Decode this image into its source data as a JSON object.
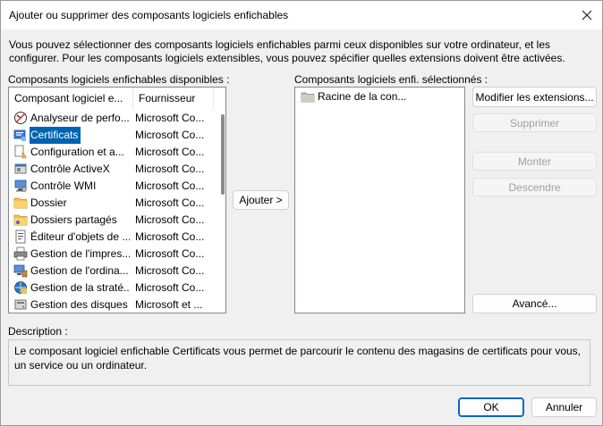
{
  "window": {
    "title": "Ajouter ou supprimer des composants logiciels enfichables",
    "close_icon": "close-icon"
  },
  "intro": "Vous pouvez sélectionner des composants logiciels enfichables parmi ceux disponibles sur votre ordinateur, et les configurer. Pour les composants logiciels extensibles, vous pouvez spécifier quelles extensions doivent être activées.",
  "available": {
    "label": "Composants logiciels enfichables disponibles :",
    "columns": [
      "Composant logiciel e...",
      "Fournisseur"
    ],
    "rows": [
      {
        "name": "Analyseur de perfo...",
        "vendor": "Microsoft Co...",
        "icon": "perf-analyzer-icon",
        "selected": false
      },
      {
        "name": "Certificats",
        "vendor": "Microsoft Co...",
        "icon": "certificates-icon",
        "selected": true
      },
      {
        "name": "Configuration et a...",
        "vendor": "Microsoft Co...",
        "icon": "config-analysis-icon",
        "selected": false
      },
      {
        "name": "Contrôle ActiveX",
        "vendor": "Microsoft Co...",
        "icon": "activex-icon",
        "selected": false
      },
      {
        "name": "Contrôle WMI",
        "vendor": "Microsoft Co...",
        "icon": "wmi-icon",
        "selected": false
      },
      {
        "name": "Dossier",
        "vendor": "Microsoft Co...",
        "icon": "folder-icon",
        "selected": false
      },
      {
        "name": "Dossiers partagés",
        "vendor": "Microsoft Co...",
        "icon": "shared-folders-icon",
        "selected": false
      },
      {
        "name": "Éditeur d'objets de ...",
        "vendor": "Microsoft Co...",
        "icon": "gpo-editor-icon",
        "selected": false
      },
      {
        "name": "Gestion de l'impres...",
        "vendor": "Microsoft Co...",
        "icon": "print-management-icon",
        "selected": false
      },
      {
        "name": "Gestion de l'ordina...",
        "vendor": "Microsoft Co...",
        "icon": "computer-management-icon",
        "selected": false
      },
      {
        "name": "Gestion de la straté...",
        "vendor": "Microsoft Co...",
        "icon": "policy-management-icon",
        "selected": false
      },
      {
        "name": "Gestion des disques",
        "vendor": "Microsoft et ...",
        "icon": "disk-management-icon",
        "selected": false
      }
    ]
  },
  "add_button": "Ajouter >",
  "selected": {
    "label": "Composants logiciels enfi. sélectionnés :",
    "items": [
      {
        "name": "Racine de la con...",
        "icon": "console-root-folder-icon"
      }
    ]
  },
  "buttons": {
    "edit_extensions": "Modifier les extensions...",
    "remove": "Supprimer",
    "move_up": "Monter",
    "move_down": "Descendre",
    "advanced": "Avancé...",
    "ok": "OK",
    "cancel": "Annuler"
  },
  "description": {
    "label": "Description :",
    "text": "Le composant logiciel enfichable Certificats vous permet de parcourir le contenu des magasins de certificats pour vous, un service ou un ordinateur."
  },
  "colors": {
    "selection": "#0063b1",
    "default_button_border": "#0067c0",
    "disabled_text": "#a0a0a0"
  }
}
